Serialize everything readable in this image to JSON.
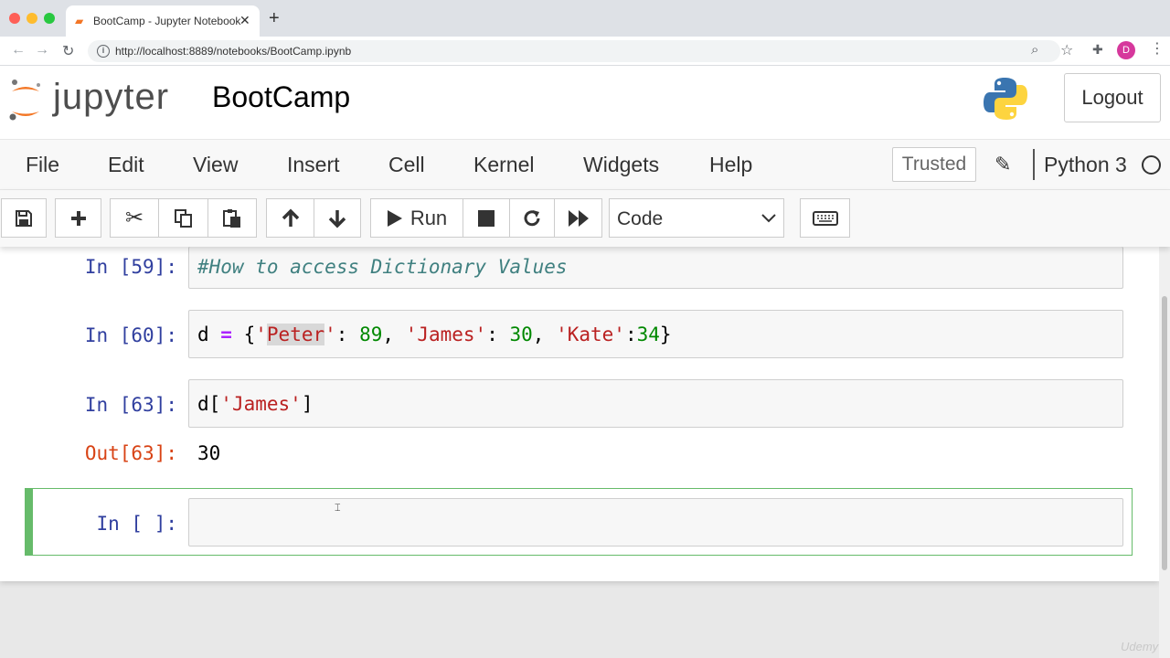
{
  "browser": {
    "tab_title": "BootCamp - Jupyter Notebook",
    "tab_close": "✕",
    "new_tab": "+",
    "url": "http://localhost:8889/notebooks/BootCamp.ipynb",
    "profile_initial": "D"
  },
  "header": {
    "logo_text": "jupyter",
    "notebook_name": "BootCamp",
    "logout_label": "Logout"
  },
  "menu": {
    "items": [
      "File",
      "Edit",
      "View",
      "Insert",
      "Cell",
      "Kernel",
      "Widgets",
      "Help"
    ],
    "trusted_label": "Trusted",
    "kernel_name": "Python 3"
  },
  "toolbar": {
    "run_label": "Run",
    "cell_type": "Code"
  },
  "cells": [
    {
      "prompt": "In [59]:",
      "type": "markdown-comment",
      "source": "#How to access Dictionary Values"
    },
    {
      "prompt": "In [60]:",
      "source": "d = {'Peter': 89, 'James': 30, 'Kate':34}"
    },
    {
      "prompt": "In [63]:",
      "source": "d['James']",
      "output_prompt": "Out[63]:",
      "output": "30"
    },
    {
      "prompt": "In [ ]:",
      "source": "",
      "selected": true
    }
  ],
  "watermark": "Udemy",
  "colors": {
    "in_prompt": "#303f9f",
    "out_prompt": "#d84315",
    "selected_cell": "#66bb6a",
    "string": "#ba2121",
    "number": "#008800",
    "operator": "#aa22ff",
    "comment": "#408080"
  }
}
